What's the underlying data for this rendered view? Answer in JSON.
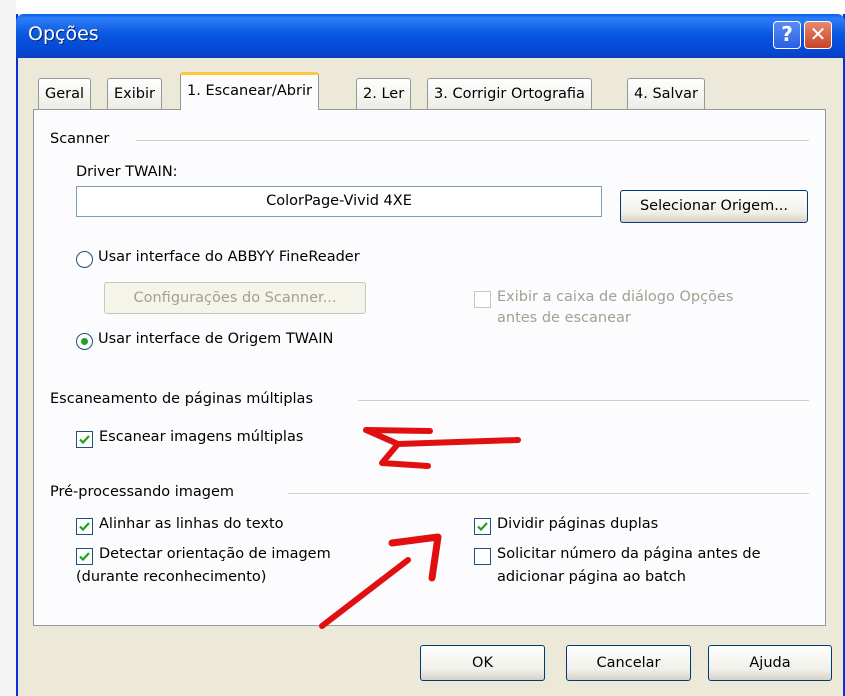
{
  "window": {
    "title": "Opções",
    "help_glyph": "?",
    "close_glyph": "✕"
  },
  "tabs": [
    "Geral",
    "Exibir",
    "1. Escanear/Abrir",
    "2. Ler",
    "3. Corrigir Ortografia",
    "4. Salvar"
  ],
  "active_tab": "1. Escanear/Abrir",
  "scanner": {
    "section_title": "Scanner",
    "driver_label": "Driver TWAIN:",
    "driver_value": "ColorPage-Vivid 4XE",
    "select_source_button": "Selecionar Origem...",
    "radio_abbyy_label": "Usar interface do ABBYY FineReader",
    "radio_abbyy_selected": false,
    "scanner_settings_button": "Configurações do Scanner...",
    "show_options_label_line1": "Exibir a caixa de diálogo Opções",
    "show_options_label_line2": "antes de escanear",
    "show_options_checked": false,
    "show_options_enabled": false,
    "radio_twain_label": "Usar interface de Origem TWAIN",
    "radio_twain_selected": true
  },
  "multipage": {
    "section_title": "Escaneamento de páginas múltiplas",
    "scan_multiple_label": "Escanear imagens múltiplas",
    "scan_multiple_checked": true
  },
  "preprocess": {
    "section_title": "Pré-processando imagem",
    "align_lines_label": "Alinhar as linhas do texto",
    "align_lines_checked": true,
    "detect_orientation_line1": "Detectar orientação de imagem",
    "detect_orientation_line2": "(durante reconhecimento)",
    "detect_orientation_checked": true,
    "split_pages_label": "Dividir páginas duplas",
    "split_pages_checked": true,
    "request_page_number_line1": "Solicitar número da página antes de",
    "request_page_number_line2": "adicionar página ao batch",
    "request_page_number_checked": false
  },
  "footer": {
    "ok": "OK",
    "cancel": "Cancelar",
    "help": "Ajuda"
  },
  "colors": {
    "title_bar": "#0b58e1",
    "dialog_face": "#ece9d8",
    "tab_highlight": "#ffc83c",
    "annotation_arrows": "#e01010"
  }
}
